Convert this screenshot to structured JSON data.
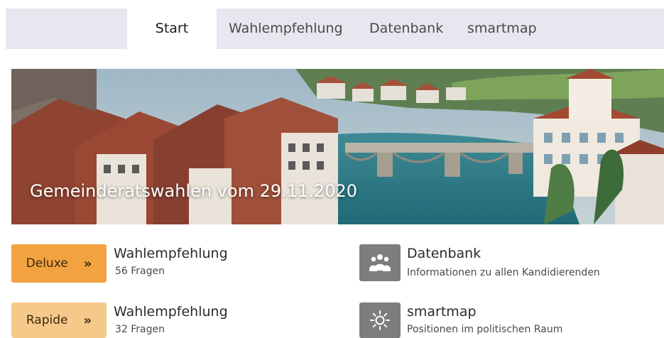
{
  "nav": {
    "tabs": [
      {
        "label": "Start",
        "active": true
      },
      {
        "label": "Wahlempfehlung",
        "active": false
      },
      {
        "label": "Datenbank",
        "active": false
      },
      {
        "label": "smartmap",
        "active": false
      }
    ]
  },
  "hero": {
    "title": "Gemeinderatswahlen vom 29.11.2020"
  },
  "options": {
    "deluxe": {
      "button_label": "Deluxe",
      "chevron": "»",
      "title": "Wahlempfehlung",
      "subtitle": "56 Fragen"
    },
    "rapide": {
      "button_label": "Rapide",
      "chevron": "»",
      "title": "Wahlempfehlung",
      "subtitle": "32 Fragen"
    }
  },
  "links": {
    "datenbank": {
      "icon": "people-group-icon",
      "title": "Datenbank",
      "subtitle": "Informationen zu allen Kandidierenden"
    },
    "smartmap": {
      "icon": "sun-icon",
      "title": "smartmap",
      "subtitle": "Positionen im politischen Raum"
    }
  },
  "colors": {
    "nav_bg": "#e7e8ef",
    "deluxe_orange": "#f2a240",
    "rapide_orange": "#f5c98a",
    "icon_grey": "#7d7d7d"
  }
}
